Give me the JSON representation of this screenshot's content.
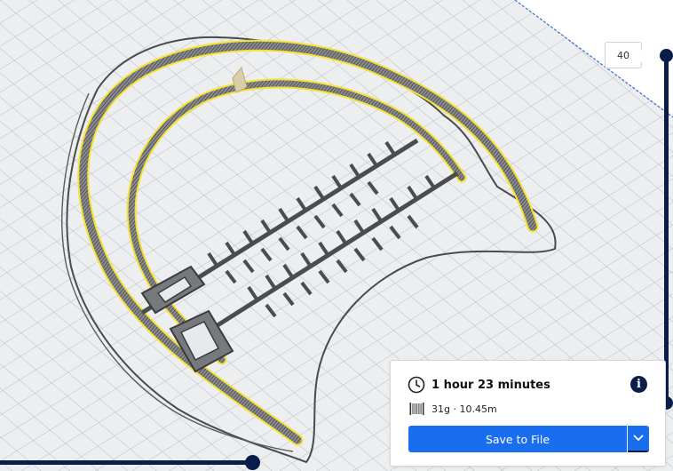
{
  "layer_view": {
    "current_layer": "40"
  },
  "print_info": {
    "time": "1 hour 23 minutes",
    "material": "31g · 10.45m",
    "save_label": "Save to File"
  },
  "icons": {
    "time": "clock-icon",
    "info": "info-icon",
    "material": "filament-spool-icon",
    "dropdown": "chevron-down-icon"
  },
  "colors": {
    "accent": "#196ef0",
    "slider": "#0a1d4a",
    "layer_highlight": "#f5e234",
    "grid_background": "#e7e9ea",
    "grid_lines": "#b9bec3"
  }
}
